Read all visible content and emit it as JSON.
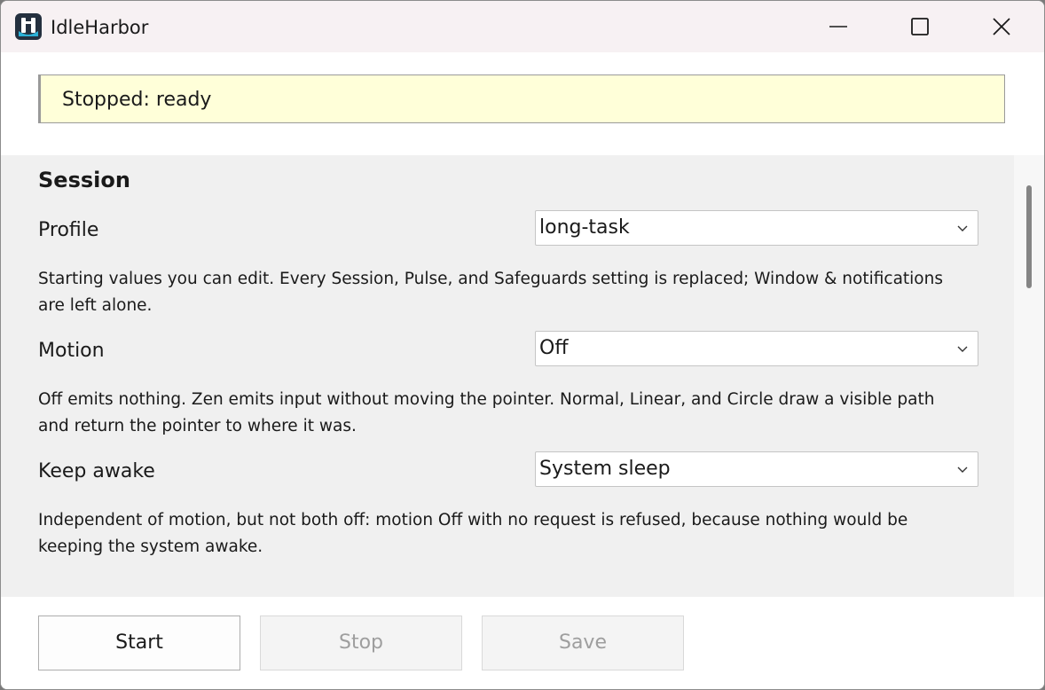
{
  "window": {
    "title": "IdleHarbor"
  },
  "status": {
    "text": "Stopped: ready"
  },
  "session": {
    "title": "Session",
    "profile": {
      "label": "Profile",
      "value": "long-task",
      "help": "Starting values you can edit. Every Session, Pulse, and Safeguards setting is replaced; Window & notifications are left alone."
    },
    "motion": {
      "label": "Motion",
      "value": "Off",
      "help": "Off emits nothing. Zen emits input without moving the pointer. Normal, Linear, and Circle draw a visible path and return the pointer to where it was."
    },
    "keep_awake": {
      "label": "Keep awake",
      "value": "System sleep",
      "help": "Independent of motion, but not both off: motion Off with no request is refused, because nothing would be keeping the system awake."
    }
  },
  "buttons": {
    "start": "Start",
    "stop": "Stop",
    "save": "Save"
  },
  "colors": {
    "status_background": "#ffffd9",
    "settings_background": "#f0f0f0",
    "titlebar_background": "#f7f1f3"
  }
}
